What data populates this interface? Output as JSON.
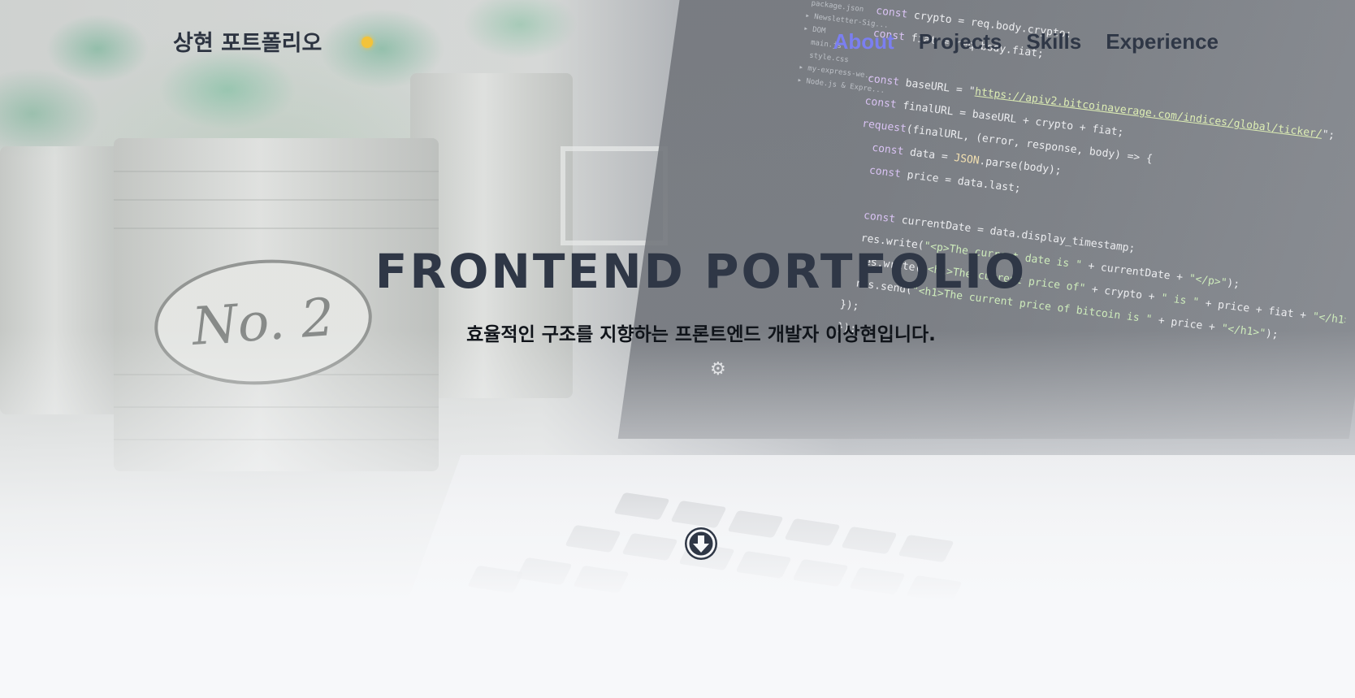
{
  "header": {
    "logo": "상현 포트폴리오",
    "theme_icon": "sun-icon",
    "nav": [
      {
        "label": "About",
        "active": true
      },
      {
        "label": "Projects",
        "active": false
      },
      {
        "label": "Skills",
        "active": false
      },
      {
        "label": "Experience",
        "active": false
      }
    ]
  },
  "hero": {
    "title": "FRONTEND PORTFOLIO",
    "subtitle": "효율적인 구조를 지향하는 프론트엔드 개발자 이상현입니다.",
    "scroll_icon": "arrow-down-circle-icon"
  },
  "colors": {
    "text_dark": "#2f3746",
    "nav_active": "#7b7ff0",
    "accent_sun": "#f3c33a",
    "page_bg": "#f7f8fa"
  }
}
